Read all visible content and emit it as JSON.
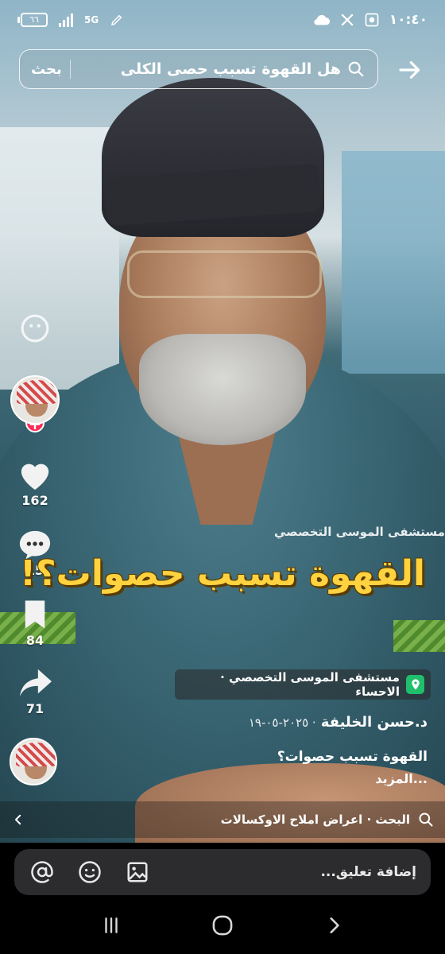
{
  "status_bar": {
    "time": "١٠:٤٠",
    "battery": "٦٦",
    "network": "5G"
  },
  "search": {
    "query": "هل القهوة تسبب حصى الكلى",
    "button_label": "بحث"
  },
  "side_rail": {
    "likes": "162",
    "comments": "15",
    "saves": "84",
    "shares": "71"
  },
  "video": {
    "headline": "القهوة تسبب حصوات؟!",
    "logo_text": "مستشفى الموسى التخصصي"
  },
  "info": {
    "location": "مستشفى الموسى التخصصي · الاحساء",
    "author": "د.حسن الخليفة",
    "date": "· ٢٠٢٥-٠٥-١٩",
    "caption": "القهوة تسبب حصوات؟",
    "more": "...المزيد"
  },
  "related_search": {
    "text": "البحث · اعراض املاح الاوكسالات"
  },
  "comment": {
    "placeholder": "إضافة تعليق..."
  },
  "colors": {
    "accent_red": "#fe2c55",
    "location_green": "#1fbf6b",
    "headline_yellow": "#ffd23f"
  }
}
